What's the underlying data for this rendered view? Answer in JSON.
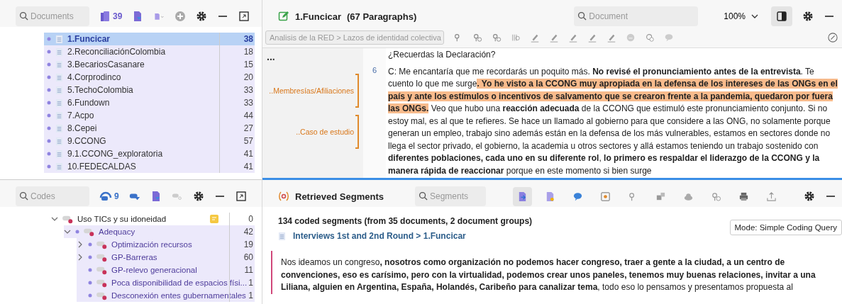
{
  "documents_pane": {
    "search": {
      "placeholder": "Documents"
    },
    "doc_count": "39",
    "items": [
      {
        "name": "1.Funcicar",
        "count": "38",
        "selected": true
      },
      {
        "name": "2.ReconciliaciónColombia",
        "count": "18",
        "selected": false
      },
      {
        "name": "3.BecariosCasanare",
        "count": "15",
        "selected": false
      },
      {
        "name": "4.Corprodinco",
        "count": "20",
        "selected": false
      },
      {
        "name": "5.TechoColombia",
        "count": "33",
        "selected": false
      },
      {
        "name": "6.Fundown",
        "count": "33",
        "selected": false
      },
      {
        "name": "7.Acpo",
        "count": "44",
        "selected": false
      },
      {
        "name": "8.Cepei",
        "count": "27",
        "selected": false
      },
      {
        "name": "9.CCONG",
        "count": "57",
        "selected": false
      },
      {
        "name": "9.1.CCONG_exploratoria",
        "count": "41",
        "selected": false
      },
      {
        "name": "10.FEDECALDAS",
        "count": "41",
        "selected": false
      }
    ]
  },
  "codes_pane": {
    "search": {
      "placeholder": "Codes"
    },
    "code_count": "9",
    "tree": [
      {
        "name": "Uso TICs y su idoneidad",
        "count": "0",
        "activated": false,
        "memo": true,
        "expanded": true,
        "children": [
          {
            "name": "Adequacy",
            "count": "42",
            "activated": true,
            "memo": false,
            "expanded": true,
            "children": [
              {
                "name": "Optimización recursos",
                "count": "19",
                "activated": true,
                "memo": false,
                "expanded": false
              },
              {
                "name": "GP-Barreras",
                "count": "60",
                "activated": true,
                "memo": false,
                "expanded": false
              },
              {
                "name": "GP-relevo generacional",
                "count": "11",
                "activated": true,
                "memo": false
              },
              {
                "name": "Poca disponibilidad de espacios físi...",
                "count": "1",
                "activated": true,
                "memo": false
              },
              {
                "name": "Desconexión entes gubernamentales",
                "count": "1",
                "activated": true,
                "memo": false
              }
            ]
          }
        ]
      }
    ]
  },
  "document_browser": {
    "title": "1.Funcicar",
    "paragraph_count": "(67 Paragraphs)",
    "search": {
      "placeholder": "Document"
    },
    "zoom": "100%",
    "code_dropdown": {
      "value": "Analisis de la RED > Lazos de identidad colectiva",
      "disabled": true
    },
    "menu": "...",
    "margin_codes": [
      {
        "label": "..Membresías/Afiliaciones"
      },
      {
        "label": "..Caso de estudio"
      }
    ],
    "previous_text": "¿Recuerdas la Declaración?",
    "paragraph": {
      "number": "6",
      "segments": [
        {
          "text": "C: Me encantaría que me recordarás un poquito más. ",
          "bold": false,
          "coded": false
        },
        {
          "text": "No revisé el pronunciamiento antes de la entrevista",
          "bold": true,
          "coded": false
        },
        {
          "text": ". Te cuento lo que me surge",
          "bold": false,
          "coded": false
        },
        {
          "text": ". Yo he visto a la CCONG muy apropiada en la defensa de los intereses de las ONGs en el país y ante los estímulos o incentivos de salvamento que se crearon frente a la pandemia, quedaron por fuera las ONGs.",
          "bold": true,
          "coded": true
        },
        {
          "text": " Veo que hubo una ",
          "bold": false,
          "coded": false
        },
        {
          "text": "reacción adecuada",
          "bold": true,
          "coded": false
        },
        {
          "text": " de la CCONG que estimuló este pronunciamiento conjunto. Si no estoy mal, es al que te refieres. Se hace un llamado al gobierno para que considere a las ONG, no solamente porque generan un empleo, trabajo sino además están en la defensa de los más vulnerables, estamos en sectores donde no llega el sector privado, el gobierno, la academia u otros sectores y allá estamos teniendo un trabajo sostenido con ",
          "bold": false,
          "coded": false
        },
        {
          "text": "diferentes poblaciones, cada uno en su diferente rol",
          "bold": true,
          "coded": false
        },
        {
          "text": ", ",
          "bold": false,
          "coded": false
        },
        {
          "text": "lo primero es respaldar el liderazgo de la CCONG y la manera rápida de reaccionar",
          "bold": true,
          "coded": false
        },
        {
          "text": " porque en este momento si bien surge",
          "bold": false,
          "coded": false
        }
      ]
    }
  },
  "retrieved_segments": {
    "title": "Retrieved Segments",
    "search": {
      "placeholder": "Segments"
    },
    "summary": "134 coded segments (from 35 documents, 2 document groups)",
    "mode": "Mode: Simple Coding Query",
    "source": "Interviews 1st and 2nd Round > 1.Funcicar",
    "segments": [
      {
        "text": "Nos ideamos un congreso",
        "bold": false
      },
      {
        "text": ", nosotros como organización no podemos hacer congreso, traer a gente a la ciudad, a un centro de convenciones, eso es carísimo, pero con la virtualidad, podemos crear unos paneles, tenemos muy buenas relaciones, invitar a una Liliana, alguien en Argentina, España, Holandés, Caribeño para canalizar tema",
        "bold": true
      },
      {
        "text": ", todo eso lo pensamos y presentamos propuesta al",
        "bold": false
      }
    ]
  }
}
